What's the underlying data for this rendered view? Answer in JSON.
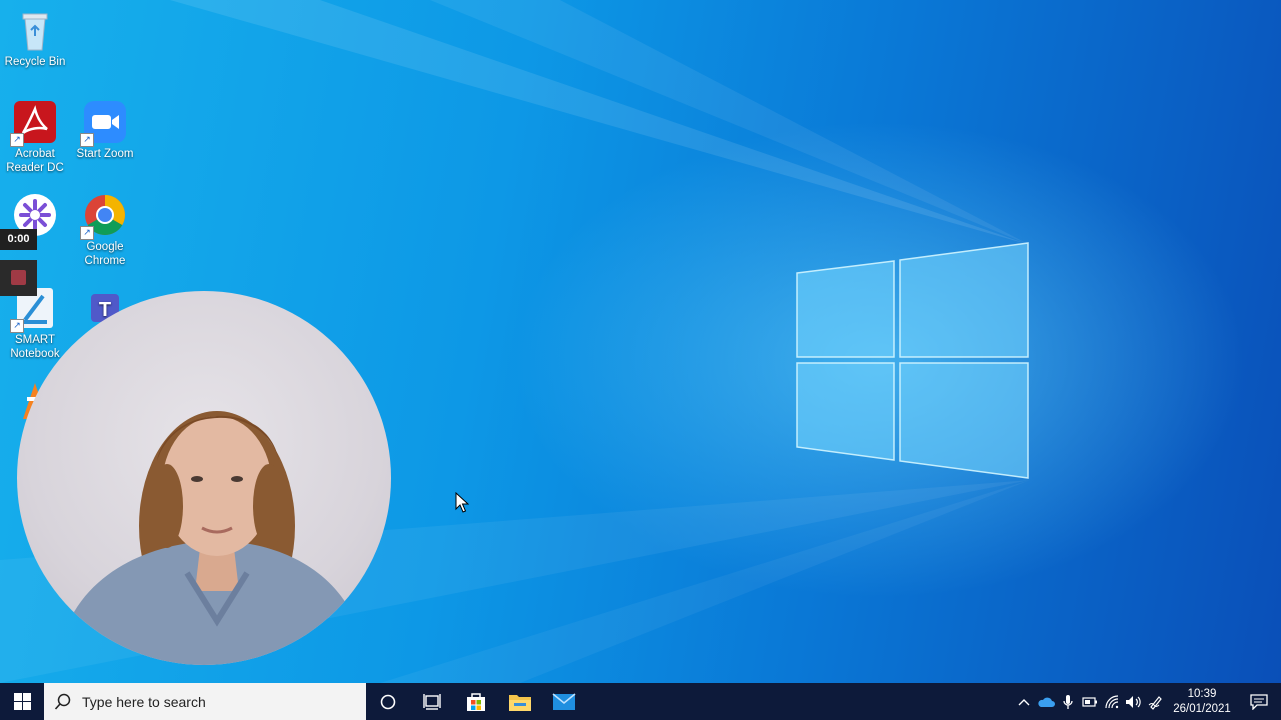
{
  "desktop": {
    "icons": [
      {
        "label": "Recycle Bin",
        "icon": "recycle-bin-icon"
      },
      {
        "label": "Acrobat Reader DC",
        "icon": "acrobat-icon"
      },
      {
        "label": "Start Zoom",
        "icon": "zoom-icon"
      },
      {
        "label": "Google Chrome",
        "icon": "chrome-icon"
      },
      {
        "label": "SMART Notebook",
        "icon": "smart-notebook-icon"
      }
    ]
  },
  "recorder": {
    "time": "0:00"
  },
  "taskbar": {
    "search_placeholder": "Type here to search",
    "clock_time": "10:39",
    "clock_date": "26/01/2021"
  },
  "colors": {
    "taskbar_bg": "#0d1a3a",
    "desktop_accent": "#0d98e6"
  }
}
